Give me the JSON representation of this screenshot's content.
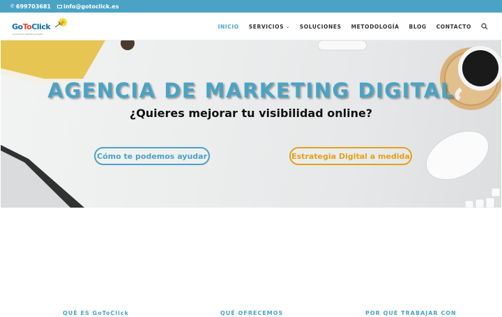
{
  "topbar": {
    "phone": "699703681",
    "email": "info@gotoclick.es"
  },
  "brand": {
    "name_go": "Go",
    "name_to": "To",
    "name_click": "Click",
    "tagline": "Consultoría Marketing Digital"
  },
  "nav": {
    "items": [
      {
        "label": "INICIO",
        "active": true
      },
      {
        "label": "SERVICIOS",
        "has_dropdown": true
      },
      {
        "label": "SOLUCIONES"
      },
      {
        "label": "METODOLOGÍA"
      },
      {
        "label": "BLOG"
      },
      {
        "label": "CONTACTO"
      }
    ],
    "search_icon": "search-icon"
  },
  "hero": {
    "title": "AGENCIA DE MARKETING DIGITAL",
    "subtitle": "¿Quieres mejorar tu visibilidad online?",
    "button_help": "Cómo te podemos ayudar",
    "button_strategy": "Estrategia Digital a medida"
  },
  "below": {
    "col1": "QUÉ ES GoToClick",
    "col2": "QUÉ OFRECEMOS",
    "col3": "POR QUÉ TRABAJAR CON"
  },
  "colors": {
    "accent": "#4aa3c4",
    "orange": "#e5a117",
    "text": "#333333"
  }
}
